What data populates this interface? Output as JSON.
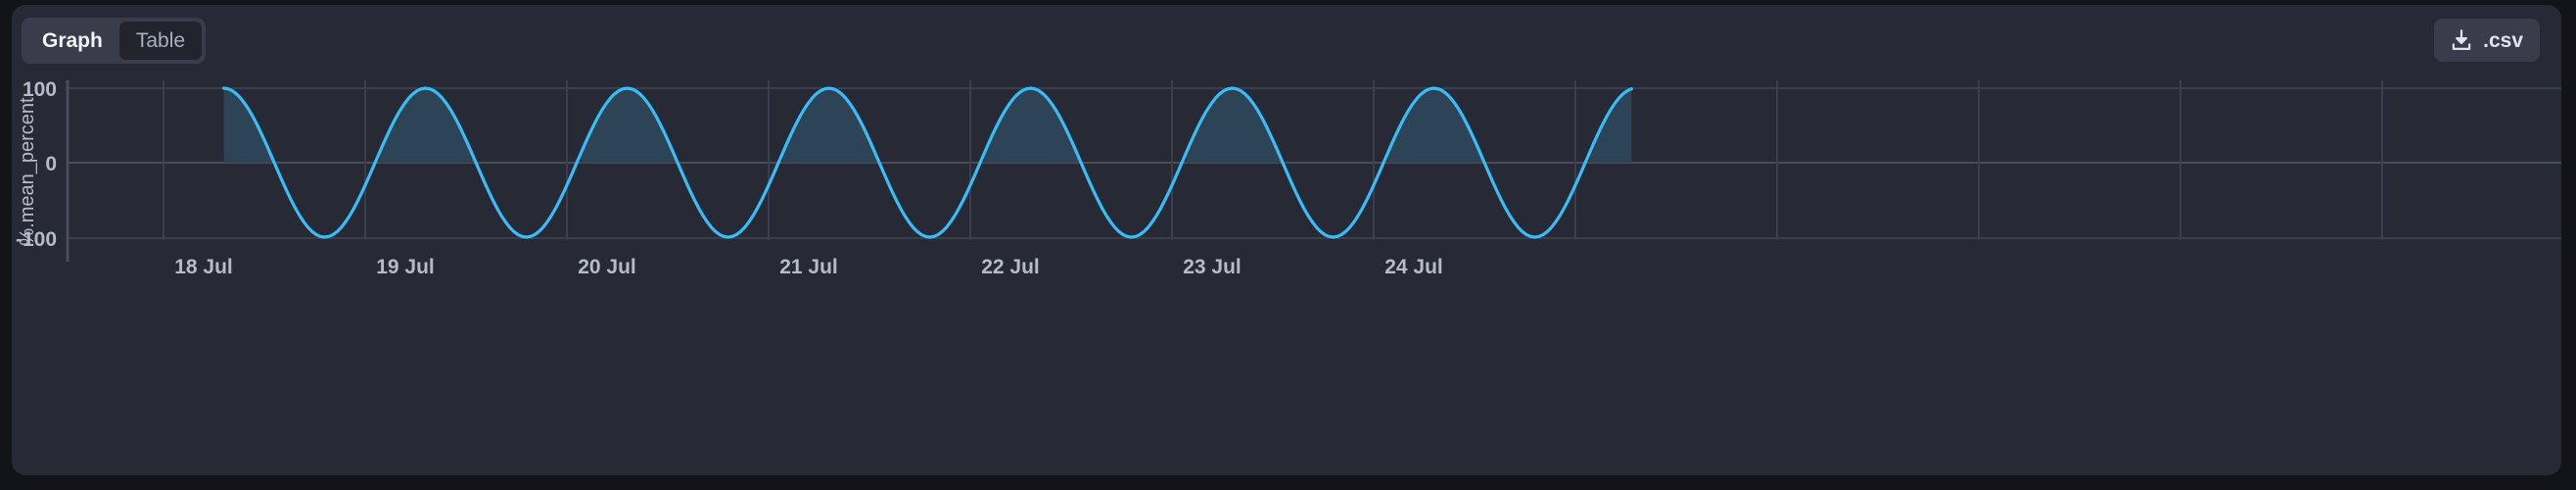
{
  "toolbar": {
    "view_toggle": {
      "options": [
        {
          "label": "Graph",
          "active": true
        },
        {
          "label": "Table",
          "active": false
        }
      ]
    },
    "export": {
      "label": ".csv",
      "icon": "download-icon"
    }
  },
  "chart_data": {
    "type": "area",
    "title": "",
    "xlabel": "",
    "ylabel": "%.mean_percent",
    "ylim": [
      -100,
      100
    ],
    "yticks": [
      100,
      0,
      -100
    ],
    "ytick_labels": [
      "100",
      "0",
      "-100"
    ],
    "xtick_labels": [
      "18 Jul",
      "19 Jul",
      "20 Jul",
      "21 Jul",
      "22 Jul",
      "23 Jul",
      "24 Jul"
    ],
    "grid": true,
    "legend": "none",
    "line_color": "#38bdf8",
    "fill_color": "#2d4356",
    "fill_below_zero": false,
    "series": [
      {
        "name": "%.mean_percent",
        "waveform": "sine",
        "amplitude": 100,
        "period_days": 1.0,
        "phase_peak_day": 18.1,
        "data_start_day": 18.1,
        "data_end_day": 25.08,
        "samples_per_day": 48,
        "description": "Sinusoid oscillating between -100 and 100 with a one-day period, beginning abruptly at its peak just after 18 Jul."
      }
    ],
    "axis_geometry": {
      "x_day_start": 17.62,
      "x_day_end": 25.08,
      "day_pixel_spacing": 206
    }
  }
}
